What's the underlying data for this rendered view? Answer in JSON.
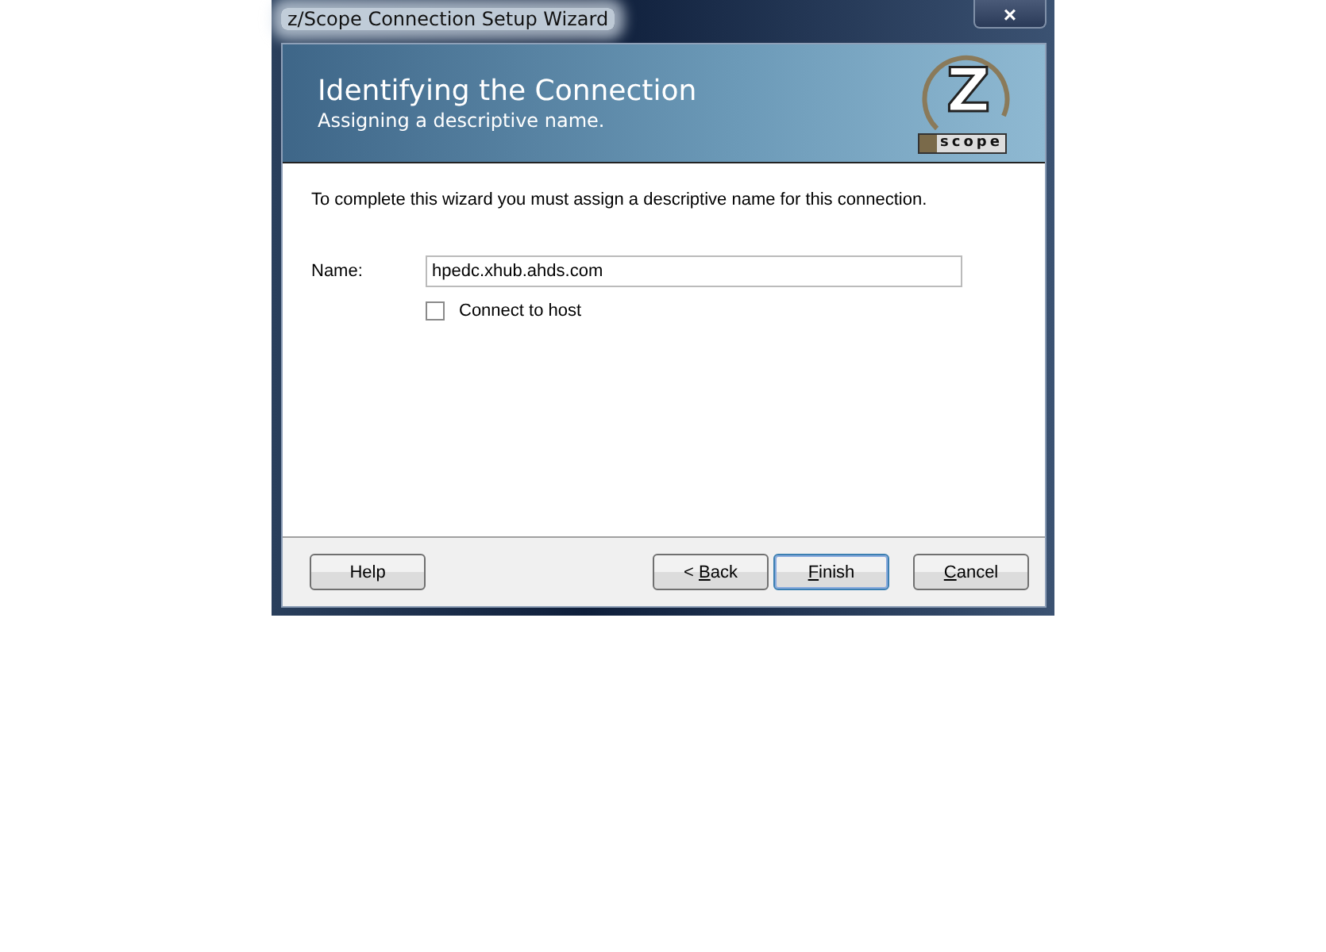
{
  "window": {
    "title": "z/Scope Connection Setup Wizard",
    "close": "×"
  },
  "header": {
    "title": "Identifying the Connection",
    "subtitle": "Assigning a descriptive name.",
    "logo_letter": "Z",
    "logo_word": "scope"
  },
  "instruction": "To complete this wizard you must assign a descriptive name for this connection.",
  "name_field": {
    "label": "Name:",
    "value": "hpedc.xhub.ahds.com"
  },
  "connect_to_host": {
    "label": "Connect to host",
    "checked": false
  },
  "buttons": [
    {
      "before": "Help",
      "default": false
    },
    {
      "before": "< ",
      "key": "B",
      "after": "ack",
      "default": false
    },
    {
      "key": "F",
      "after": "inish",
      "default": true
    },
    {
      "key": "C",
      "after": "ancel",
      "default": false
    }
  ]
}
